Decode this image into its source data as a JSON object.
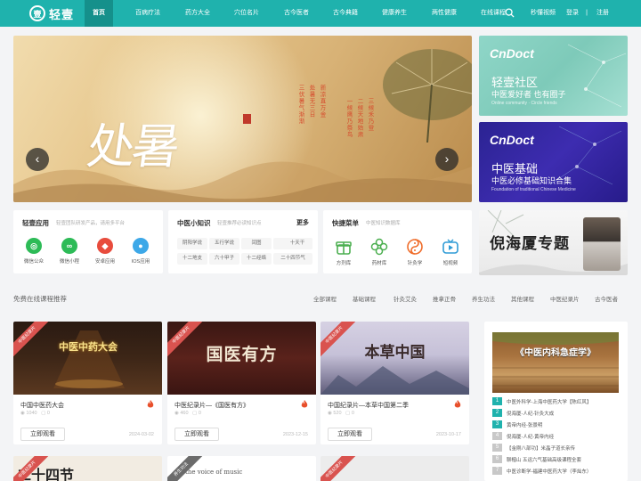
{
  "nav": {
    "logo_text": "轻壹",
    "logo_mark": "壹",
    "items": [
      "首页",
      "百病疗法",
      "药方大全",
      "穴位名片",
      "古今医者",
      "古今典籍",
      "健康养生",
      "两性健康",
      "在线课程",
      "秒懂视频",
      "登录",
      "注册"
    ],
    "search_icon": "search-icon"
  },
  "hero": {
    "calligraphy": "处暑",
    "vertical_texts": [
      "三伏暑气渐渐",
      "处暑无三日",
      "新凉直万金",
      "一候鹰乃祭鸟",
      "二候天地始肃",
      "三候禾乃登"
    ],
    "prev_icon": "‹",
    "next_icon": "›"
  },
  "side_banners": [
    {
      "brand": "CnDoct",
      "title": "轻壹社区",
      "subtitle": "中医爱好者 也有圈子",
      "english": "Online community · Circle friends"
    },
    {
      "brand": "CnDoct",
      "title": "中医基础",
      "subtitle": "中医必修基础知识合集",
      "english": "Foundation of traditional Chinese Medicine"
    }
  ],
  "apps_card": {
    "title": "轻壹应用",
    "desc": "轻壹团队研发产品，请用多平台",
    "apps": [
      {
        "label": "微信公众",
        "color": "#2dbb57",
        "glyph": "◎"
      },
      {
        "label": "微信小程",
        "color": "#2dbb57",
        "glyph": "∞"
      },
      {
        "label": "安卓应用",
        "color": "#e84c3d",
        "glyph": "◆"
      },
      {
        "label": "IOS应用",
        "color": "#3da8e8",
        "glyph": "●"
      }
    ]
  },
  "knowledge_card": {
    "title": "中医小知识",
    "desc": "轻壹推荐必读知识点",
    "more": "更多",
    "tags": [
      "阴阳学说",
      "五行学说",
      "闰图",
      "道书",
      "十天干",
      "十二地支",
      "六十甲子",
      "十二经络",
      "二十四节气"
    ]
  },
  "menu_card": {
    "title": "快捷菜单",
    "desc": "中医知识数据库",
    "items": [
      {
        "label": "方剂库",
        "color": "#4caf50"
      },
      {
        "label": "药材库",
        "color": "#4caf50"
      },
      {
        "label": "针灸学",
        "color": "#ef6c2a"
      },
      {
        "label": "短视频",
        "color": "#2f9bd6"
      }
    ]
  },
  "promo": {
    "text": "倪海厦专题"
  },
  "courses_section": {
    "title": "免费在线课程推荐",
    "filters": [
      "全部课程",
      "基础课程",
      "针灸艾灸",
      "推拿正骨",
      "养生功法",
      "其他课程",
      "中医纪录片",
      "古今医者"
    ]
  },
  "courses": [
    {
      "ribbon": "中医纪录片",
      "thumb_text": "中医中药大会",
      "title": "中国中医药大会",
      "views": "1040",
      "comments": "0",
      "button": "立即观看",
      "date": "2024-03-02"
    },
    {
      "ribbon": "中医纪录片",
      "thumb_text": "国医有方",
      "title": "中医纪录片—《国医有方》",
      "views": "460",
      "comments": "0",
      "button": "立即观看",
      "date": "2023-12-15"
    },
    {
      "ribbon": "中医纪录片",
      "thumb_text": "本草中国",
      "title": "中国纪录片—本草中国第二季",
      "views": "520",
      "comments": "0",
      "button": "立即观看",
      "date": "2023-10-17"
    }
  ],
  "courses_row2": [
    {
      "ribbon": "中医纪录片",
      "thumb_text": "二十四节"
    },
    {
      "ribbon": "养生功法",
      "thumb_text": "the voice of music"
    },
    {
      "ribbon": "中医纪录片",
      "thumb_text": ""
    }
  ],
  "right_list": {
    "image_title": "《中医内科急症学》",
    "items": [
      "中医外科学-上海中医药大学【陈红风】",
      "倪海厦-人纪-针灸大成",
      "黄帝内经-张景明",
      "倪海厦-人纪-黄帝内经",
      "【金刚八部功】米晶子道长亲传",
      "聊楷山 五运六气基础高级课程全套",
      "中医诊断学-福建中医药大学（李灿东）"
    ]
  }
}
